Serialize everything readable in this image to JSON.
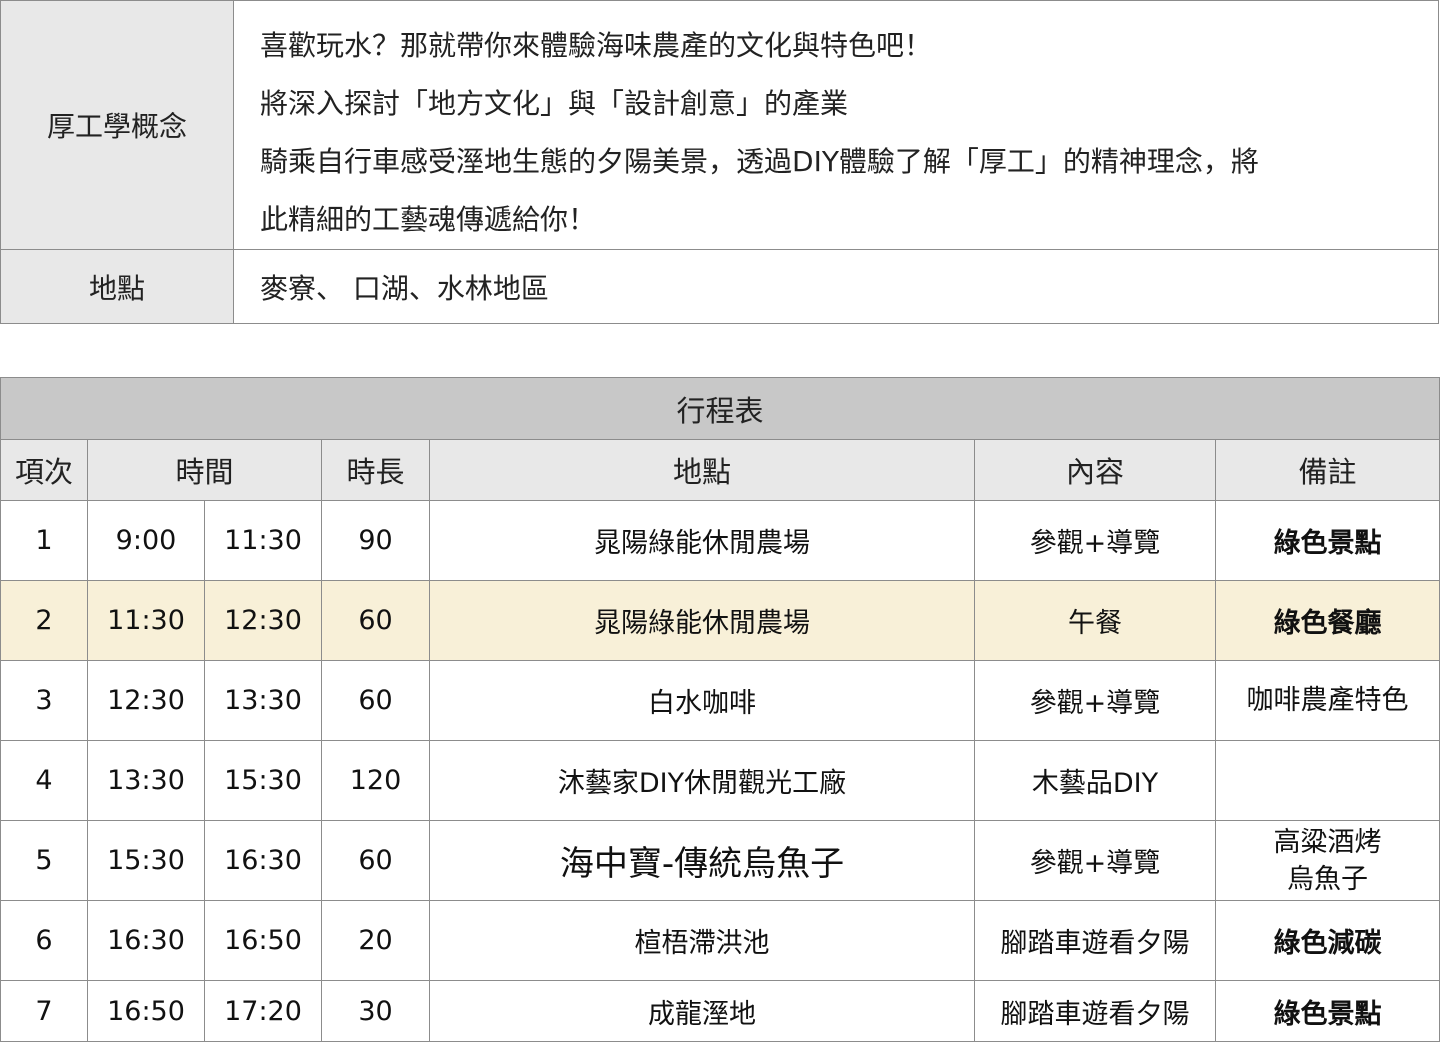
{
  "concept": {
    "label": "厚工學概念",
    "lines": [
      "喜歡玩水？那就帶你來體驗海味農產的文化與特色吧！",
      "將深入探討「地方文化」與「設計創意」的產業",
      "騎乘自行車感受溼地生態的夕陽美景，透過DIY體驗了解「厚工」的精神理念，將",
      "此精細的工藝魂傳遞給你！"
    ]
  },
  "location": {
    "label": "地點",
    "value": "麥寮、 口湖、水林地區"
  },
  "schedule": {
    "title": "行程表",
    "headers": {
      "index": "項次",
      "time": "時間",
      "duration": "時長",
      "place": "地點",
      "content": "內容",
      "note": "備註"
    },
    "rows": [
      {
        "index": "1",
        "start": "9:00",
        "end": "11:30",
        "duration": "90",
        "place": "晁陽綠能休閒農場",
        "content": "參觀+導覽",
        "note": "綠色景點"
      },
      {
        "index": "2",
        "start": "11:30",
        "end": "12:30",
        "duration": "60",
        "place": "晁陽綠能休閒農場",
        "content": "午餐",
        "note": "綠色餐廳"
      },
      {
        "index": "3",
        "start": "12:30",
        "end": "13:30",
        "duration": "60",
        "place": "白水咖啡",
        "content": "參觀+導覽",
        "note": "咖啡農產特色"
      },
      {
        "index": "4",
        "start": "13:30",
        "end": "15:30",
        "duration": "120",
        "place": "沐藝家DIY休閒觀光工廠",
        "content": "木藝品DIY",
        "note": ""
      },
      {
        "index": "5",
        "start": "15:30",
        "end": "16:30",
        "duration": "60",
        "place": "海中寶-傳統烏魚子",
        "content": "參觀+導覽",
        "note_line1": "高粱酒烤",
        "note_line2": "烏魚子"
      },
      {
        "index": "6",
        "start": "16:30",
        "end": "16:50",
        "duration": "20",
        "place": "楦梧滯洪池",
        "content": "腳踏車遊看夕陽",
        "note": "綠色減碳"
      },
      {
        "index": "7",
        "start": "16:50",
        "end": "17:20",
        "duration": "30",
        "place": "成龍溼地",
        "content": "腳踏車遊看夕陽",
        "note": "綠色景點"
      }
    ]
  },
  "colors": {
    "green_note": "#2eaa4a",
    "highlight_row": "#f8f0d8",
    "header_bg": "#e8e8e8",
    "title_bg": "#c8c8c8"
  }
}
